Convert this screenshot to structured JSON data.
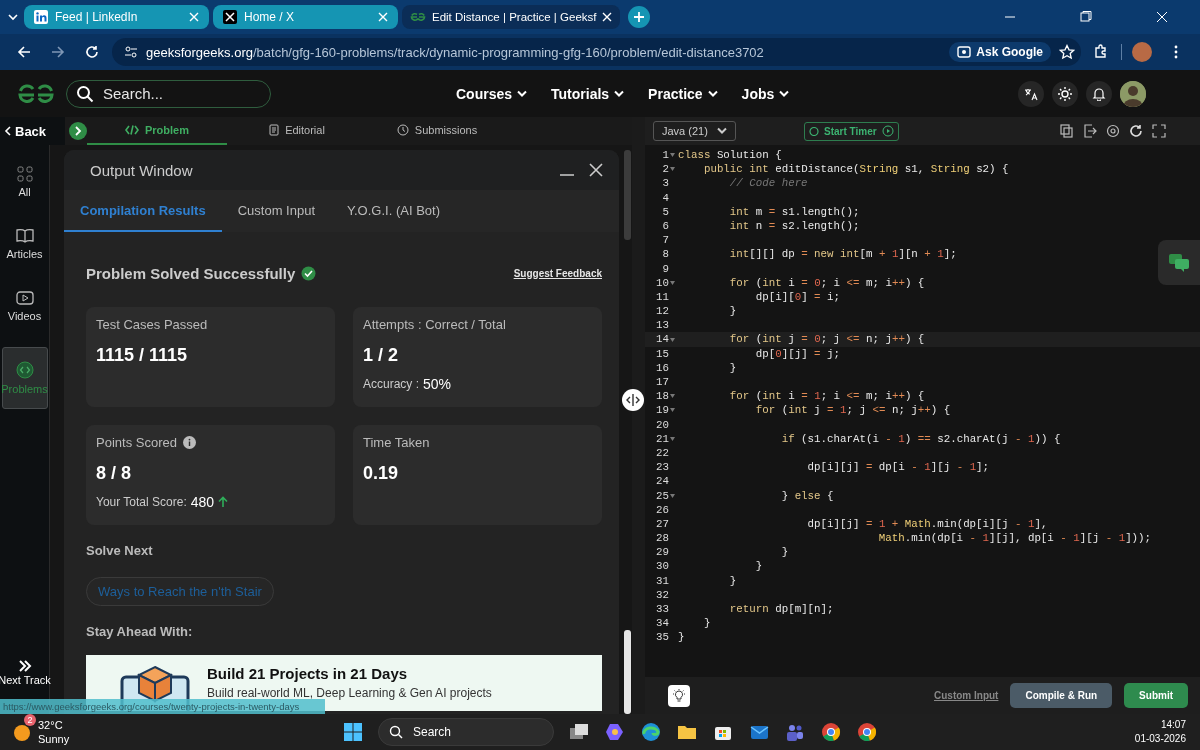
{
  "browser": {
    "tabs": [
      {
        "label": "Feed | LinkedIn",
        "selected": false
      },
      {
        "label": "Home / X",
        "selected": false
      },
      {
        "label": "Edit Distance | Practice | Geeksf",
        "selected": true
      }
    ],
    "address": {
      "domain": "geeksforgeeks.org",
      "path": "/batch/gfg-160-problems/track/dynamic-programming-gfg-160/problem/edit-distance3702"
    },
    "ask_google": "Ask Google"
  },
  "site_header": {
    "search": {
      "placeholder": "Search..."
    },
    "nav": [
      "Courses",
      "Tutorials",
      "Practice",
      "Jobs"
    ]
  },
  "back": "Back",
  "problem_tabs": [
    {
      "label": "Problem",
      "selected": true
    },
    {
      "label": "Editorial",
      "selected": false
    },
    {
      "label": "Submissions",
      "selected": false
    }
  ],
  "sidebar": {
    "items": [
      {
        "label": "All",
        "selected": false
      },
      {
        "label": "Articles",
        "selected": false
      },
      {
        "label": "Videos",
        "selected": false
      },
      {
        "label": "Problems",
        "selected": true
      }
    ],
    "next_track": "Next Track"
  },
  "output_window": {
    "title": "Output Window",
    "tabs": [
      {
        "label": "Compilation Results",
        "selected": true
      },
      {
        "label": "Custom Input",
        "selected": false
      },
      {
        "label": "Y.O.G.I. (AI Bot)",
        "selected": false
      }
    ],
    "status": "Problem Solved Successfully",
    "feedback": "Suggest Feedback",
    "cards": [
      {
        "label": "Test Cases Passed",
        "value": "1115 / 1115",
        "info": false
      },
      {
        "label": "Attempts : Correct / Total",
        "value": "1 / 2",
        "info": false,
        "note": {
          "label": "Accuracy :",
          "value": "50%",
          "rising": false
        }
      },
      {
        "label": "Points Scored",
        "value": "8 / 8",
        "info": true,
        "note": {
          "label": "Your Total Score:",
          "value": "480",
          "rising": true
        }
      },
      {
        "label": "Time Taken",
        "value": "0.19",
        "info": false
      }
    ],
    "solve_next": {
      "heading": "Solve Next",
      "link": "Ways to Reach the n'th Stair"
    },
    "stay_ahead": {
      "heading": "Stay Ahead With:",
      "title": "Build 21 Projects in 21 Days",
      "subtitle": "Build real-world ML, Deep Learning & Gen AI projects"
    }
  },
  "status_url": "https://www.geeksforgeeks.org/courses/twenty-projects-in-twenty-days",
  "editor": {
    "language": "Java (21)",
    "timer": "Start Timer",
    "lines": [
      {
        "no": "1",
        "text": "class Solution {",
        "fold": true,
        "current": false
      },
      {
        "no": "2",
        "text": "    public int editDistance(String s1, String s2) {",
        "fold": true,
        "current": false
      },
      {
        "no": "3",
        "text": "        // Code here",
        "fold": false,
        "current": false
      },
      {
        "no": "4",
        "fold": false,
        "current": false
      },
      {
        "no": "5",
        "text": "        int m = s1.length();",
        "fold": false,
        "current": false
      },
      {
        "no": "6",
        "text": "        int n = s2.length();",
        "fold": false,
        "current": false
      },
      {
        "no": "7",
        "fold": false,
        "current": false
      },
      {
        "no": "8",
        "text": "        int[][] dp = new int[m + 1][n + 1];",
        "fold": false,
        "current": false
      },
      {
        "no": "9",
        "fold": false,
        "current": false
      },
      {
        "no": "10",
        "text": "        for (int i = 0; i <= m; i++) {",
        "fold": true,
        "current": false
      },
      {
        "no": "11",
        "text": "            dp[i][0] = i;",
        "fold": false,
        "current": false
      },
      {
        "no": "12",
        "text": "        }",
        "fold": false,
        "current": false
      },
      {
        "no": "13",
        "fold": false,
        "current": false
      },
      {
        "no": "14",
        "text": "        for (int j = 0; j <= n; j++) {",
        "fold": true,
        "current": true
      },
      {
        "no": "15",
        "text": "            dp[0][j] = j;",
        "fold": false,
        "current": false
      },
      {
        "no": "16",
        "text": "        }",
        "fold": false,
        "current": false
      },
      {
        "no": "17",
        "fold": false,
        "current": false
      },
      {
        "no": "18",
        "text": "        for (int i = 1; i <= m; i++) {",
        "fold": true,
        "current": false
      },
      {
        "no": "19",
        "text": "            for (int j = 1; j <= n; j++) {",
        "fold": true,
        "current": false
      },
      {
        "no": "20",
        "fold": false,
        "current": false
      },
      {
        "no": "21",
        "text": "                if (s1.charAt(i - 1) == s2.charAt(j - 1)) {",
        "fold": true,
        "current": false
      },
      {
        "no": "22",
        "fold": false,
        "current": false
      },
      {
        "no": "23",
        "text": "                    dp[i][j] = dp[i - 1][j - 1];",
        "fold": false,
        "current": false
      },
      {
        "no": "24",
        "fold": false,
        "current": false
      },
      {
        "no": "25",
        "text": "                } else {",
        "fold": true,
        "current": false
      },
      {
        "no": "26",
        "fold": false,
        "current": false
      },
      {
        "no": "27",
        "text": "                    dp[i][j] = 1 + Math.min(dp[i][j - 1],",
        "fold": false,
        "current": false
      },
      {
        "no": "28",
        "text": "                               Math.min(dp[i - 1][j], dp[i - 1][j - 1]));",
        "fold": false,
        "current": false
      },
      {
        "no": "29",
        "text": "                }",
        "fold": false,
        "current": false
      },
      {
        "no": "30",
        "text": "            }",
        "fold": false,
        "current": false
      },
      {
        "no": "31",
        "text": "        }",
        "fold": false,
        "current": false
      },
      {
        "no": "32",
        "fold": false,
        "current": false
      },
      {
        "no": "33",
        "text": "        return dp[m][n];",
        "fold": false,
        "current": false
      },
      {
        "no": "34",
        "text": "    }",
        "fold": false,
        "current": false
      },
      {
        "no": "35",
        "text": "}",
        "fold": false,
        "current": false
      }
    ],
    "footer": {
      "custom_input": "Custom Input",
      "compile": "Compile & Run",
      "submit": "Submit"
    }
  },
  "taskbar": {
    "weather": {
      "badge": "2",
      "temp": "32°C",
      "condition": "Sunny"
    },
    "search": "Search",
    "time": "14:07",
    "date": "01-03-2026"
  }
}
